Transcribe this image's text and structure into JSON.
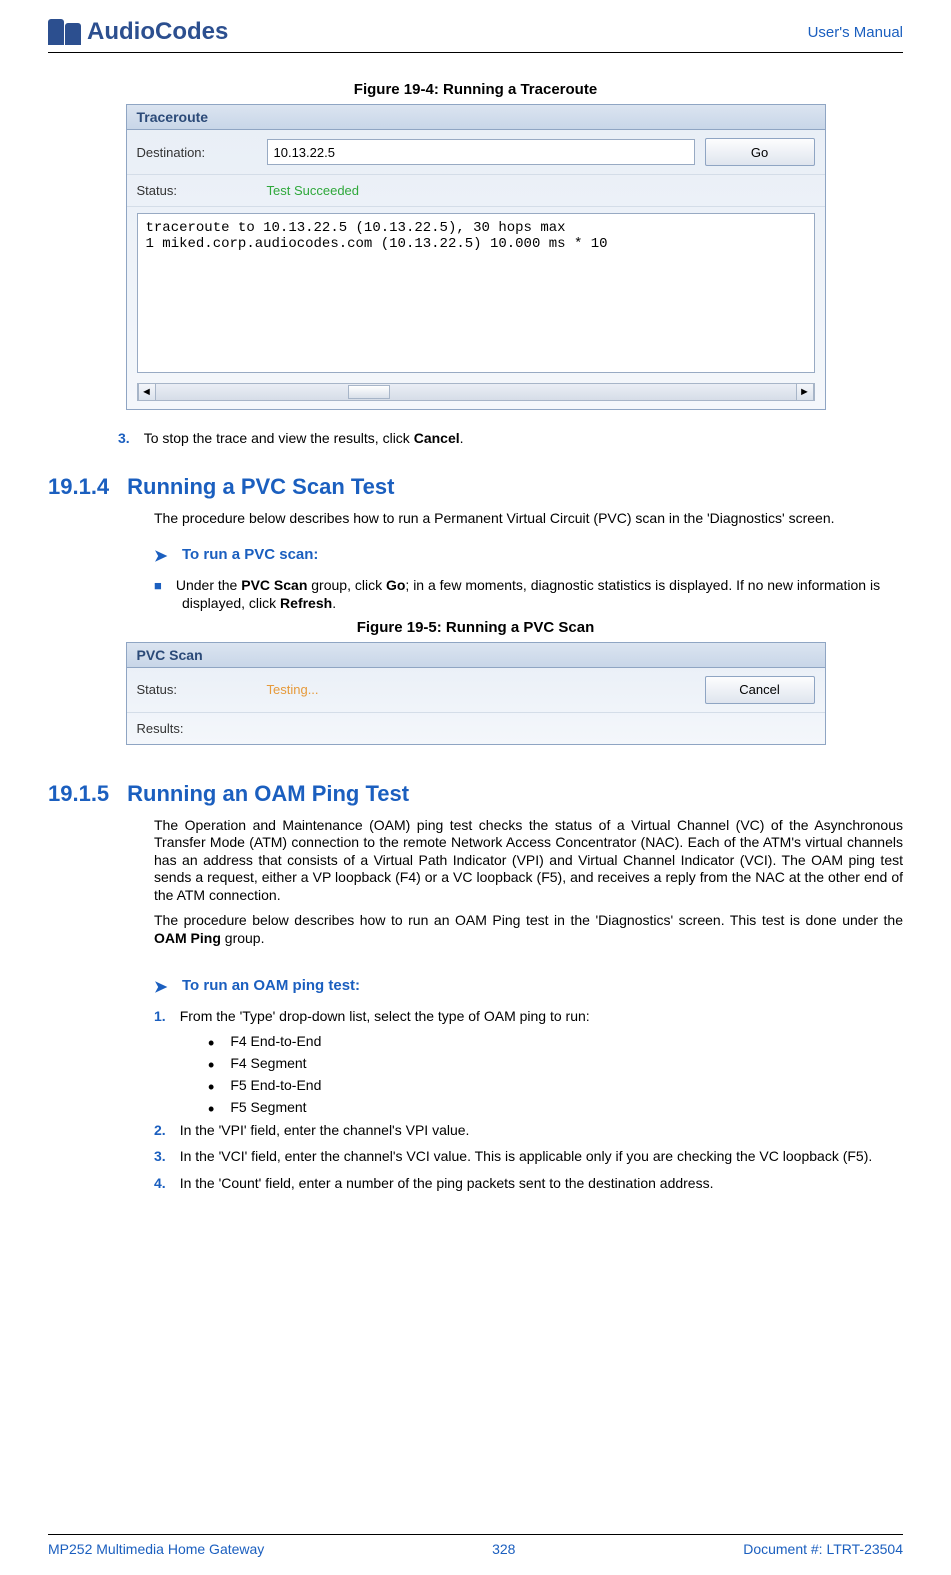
{
  "header": {
    "logo_text": "AudioCodes",
    "right": "User's Manual"
  },
  "fig1": {
    "caption": "Figure 19-4: Running a Traceroute",
    "panel_title": "Traceroute",
    "dest_label": "Destination:",
    "dest_value": "10.13.22.5",
    "go_label": "Go",
    "status_label": "Status:",
    "status_value": "Test Succeeded",
    "output": "traceroute to 10.13.22.5 (10.13.22.5), 30 hops max\n1 miked.corp.audiocodes.com (10.13.22.5) 10.000 ms * 10"
  },
  "step3": {
    "num": "3.",
    "pre": "To stop the trace and view the results, click ",
    "bold": "Cancel",
    "post": "."
  },
  "sec1": {
    "num": "19.1.4",
    "title": "Running a PVC Scan Test",
    "para": "The procedure below describes how to run a Permanent Virtual Circuit (PVC) scan in the 'Diagnostics' screen.",
    "proc_heading": "To run a PVC scan:",
    "bullet_pre": "Under the ",
    "bullet_b1": "PVC Scan",
    "bullet_mid1": " group, click ",
    "bullet_b2": "Go",
    "bullet_mid2": "; in a few moments, diagnostic statistics is displayed. If no new information is displayed, click ",
    "bullet_b3": "Refresh",
    "bullet_post": "."
  },
  "fig2": {
    "caption": "Figure 19-5: Running a PVC Scan",
    "panel_title": "PVC Scan",
    "status_label": "Status:",
    "status_value": "Testing...",
    "cancel_label": "Cancel",
    "results_label": "Results:"
  },
  "sec2": {
    "num": "19.1.5",
    "title": "Running an OAM Ping Test",
    "para1": "The Operation and Maintenance (OAM) ping test checks the status of a Virtual Channel (VC) of the Asynchronous Transfer Mode (ATM) connection to the remote Network Access Concentrator (NAC). Each of the ATM's virtual channels has an address that consists of a Virtual Path Indicator (VPI) and Virtual Channel Indicator (VCI). The OAM ping test sends a request, either a VP loopback (F4) or a VC loopback (F5), and receives a reply from the NAC at the other end of the ATM connection.",
    "para2_pre": "The procedure below describes how to run an OAM Ping test in the 'Diagnostics' screen. This test is done under the ",
    "para2_bold": "OAM Ping",
    "para2_post": " group.",
    "proc_heading": "To run an OAM ping test:",
    "step1": {
      "num": "1.",
      "text": "From the 'Type' drop-down list, select the type of OAM ping to run:"
    },
    "sub": {
      "a": "F4 End-to-End",
      "b": "F4 Segment",
      "c": "F5 End-to-End",
      "d": "F5 Segment"
    },
    "step2": {
      "num": "2.",
      "text": "In the 'VPI' field, enter the channel's VPI value."
    },
    "step3": {
      "num": "3.",
      "text": "In the 'VCI' field, enter the channel's VCI value. This is applicable only if you are checking the VC loopback (F5)."
    },
    "step4": {
      "num": "4.",
      "text": "In the 'Count' field, enter a number of the ping packets sent to the destination address."
    }
  },
  "footer": {
    "left": "MP252 Multimedia Home Gateway",
    "center": "328",
    "right": "Document #: LTRT-23504"
  }
}
